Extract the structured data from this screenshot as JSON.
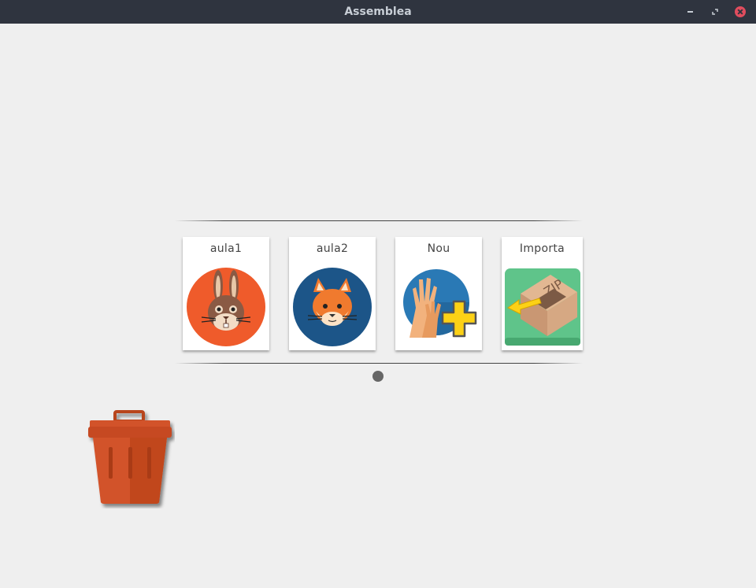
{
  "window": {
    "title": "Assemblea",
    "controls": {
      "minimize": "minimize-icon",
      "maximize": "maximize-icon",
      "close": "close-icon"
    }
  },
  "carousel": {
    "cards": [
      {
        "label": "aula1",
        "icon": "rabbit-icon",
        "color": "#ef5b2b"
      },
      {
        "label": "aula2",
        "icon": "fox-icon",
        "color": "#1c5588"
      },
      {
        "label": "Nou",
        "icon": "hands-plus-icon",
        "color": "#2a79b5"
      },
      {
        "label": "Importa",
        "icon": "zip-import-icon",
        "color": "#5fc48a"
      }
    ],
    "pages": 1,
    "current_page": 1
  },
  "trash": {
    "icon": "trash-icon",
    "color": "#d2532c"
  },
  "colors": {
    "background": "#efefef",
    "titlebar": "#2f343f",
    "close_button": "#e14d5e"
  }
}
